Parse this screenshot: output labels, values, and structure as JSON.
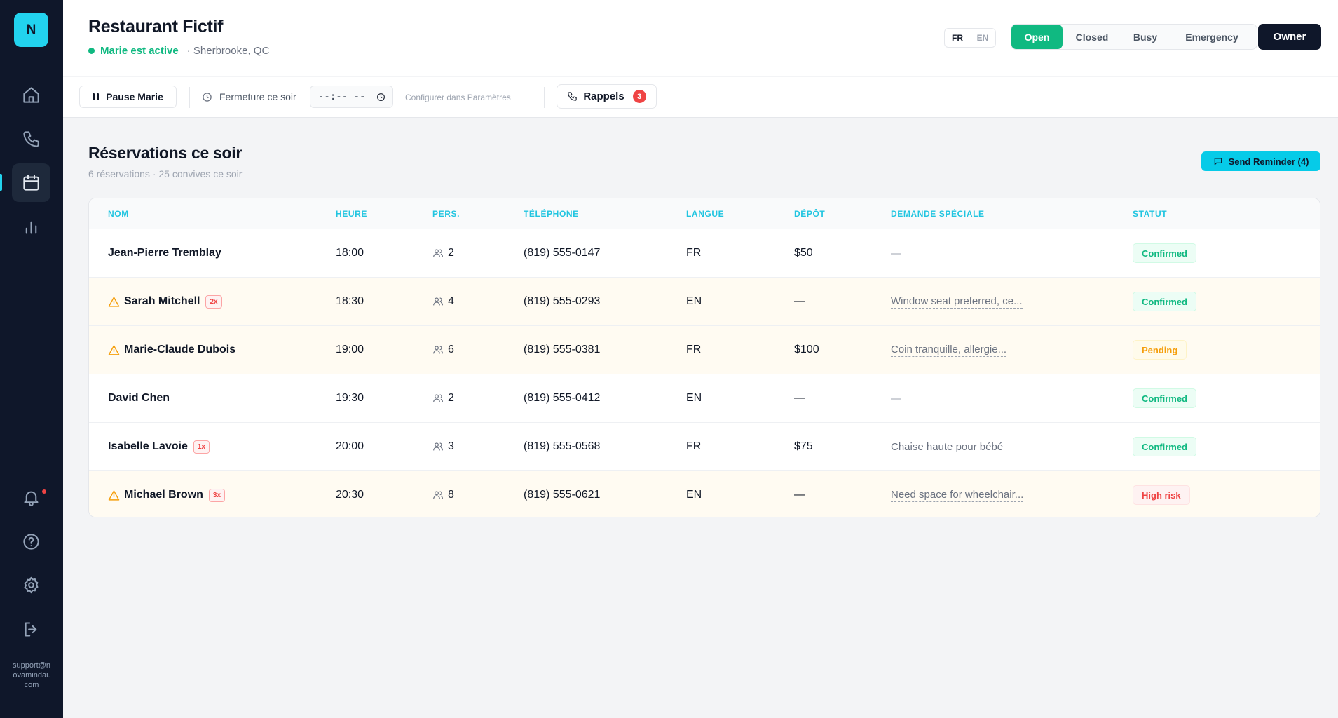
{
  "sidebar": {
    "logo_letter": "N",
    "items": [
      {
        "name": "home-icon"
      },
      {
        "name": "phone-icon"
      },
      {
        "name": "calendar-icon",
        "active": true
      },
      {
        "name": "bar-chart-icon"
      },
      {
        "name": "bell-icon",
        "notification": true
      },
      {
        "name": "help-icon"
      },
      {
        "name": "gear-icon"
      },
      {
        "name": "logout-icon"
      }
    ],
    "support_email": "support@novamindai.com"
  },
  "header": {
    "restaurant_name": "Restaurant Fictif",
    "agent_status": "Marie est active",
    "location": "· Sherbrooke, QC",
    "lang_fr": "FR",
    "lang_en": "EN",
    "selected_lang": "FR",
    "status_buttons": {
      "open": "Open",
      "closed": "Closed",
      "busy": "Busy",
      "emergency": "Emergency"
    },
    "selected_status": "Open",
    "owner_label": "Owner"
  },
  "toolbar": {
    "pause_label": "Pause Marie",
    "closing_label": "Fermeture ce soir",
    "time_value": "--:-- --",
    "config_hint": "Configurer dans Paramètres",
    "reminders_label": "Rappels",
    "reminders_count": "3"
  },
  "main": {
    "title": "Réservations ce soir",
    "subtitle": "6 réservations · 25 convives ce soir",
    "send_reminder_label": "Send Reminder (4)",
    "columns": [
      "NOM",
      "HEURE",
      "PERS.",
      "TÉLÉPHONE",
      "LANGUE",
      "DÉPÔT",
      "DEMANDE SPÉCIALE",
      "STATUT"
    ],
    "rows": [
      {
        "name": "Jean-Pierre Tremblay",
        "warn": false,
        "noshow": "",
        "time": "18:00",
        "party": "2",
        "phone": "(819) 555-0147",
        "lang": "FR",
        "deposit": "$50",
        "request": "—",
        "request_link": false,
        "status": "Confirmed",
        "status_kind": "confirmed"
      },
      {
        "name": "Sarah Mitchell",
        "warn": true,
        "noshow": "2x",
        "time": "18:30",
        "party": "4",
        "phone": "(819) 555-0293",
        "lang": "EN",
        "deposit": "—",
        "request": "Window seat preferred, ce...",
        "request_link": true,
        "status": "Confirmed",
        "status_kind": "confirmed"
      },
      {
        "name": "Marie-Claude Dubois",
        "warn": true,
        "noshow": "",
        "time": "19:00",
        "party": "6",
        "phone": "(819) 555-0381",
        "lang": "FR",
        "deposit": "$100",
        "request": "Coin tranquille, allergie...",
        "request_link": true,
        "status": "Pending",
        "status_kind": "pending"
      },
      {
        "name": "David Chen",
        "warn": false,
        "noshow": "",
        "time": "19:30",
        "party": "2",
        "phone": "(819) 555-0412",
        "lang": "EN",
        "deposit": "—",
        "request": "—",
        "request_link": false,
        "status": "Confirmed",
        "status_kind": "confirmed"
      },
      {
        "name": "Isabelle Lavoie",
        "warn": false,
        "noshow": "1x",
        "time": "20:00",
        "party": "3",
        "phone": "(819) 555-0568",
        "lang": "FR",
        "deposit": "$75",
        "request": "Chaise haute pour bébé",
        "request_link": false,
        "status": "Confirmed",
        "status_kind": "confirmed"
      },
      {
        "name": "Michael Brown",
        "warn": true,
        "noshow": "3x",
        "time": "20:30",
        "party": "8",
        "phone": "(819) 555-0621",
        "lang": "EN",
        "deposit": "—",
        "request": "Need space for wheelchair...",
        "request_link": true,
        "status": "High risk",
        "status_kind": "highrisk"
      }
    ]
  },
  "colors": {
    "accent": "#22d3ee",
    "open_green": "#10b981",
    "sidebar_bg": "#0f172a",
    "warning": "#f59e0b",
    "danger": "#ef4444"
  }
}
